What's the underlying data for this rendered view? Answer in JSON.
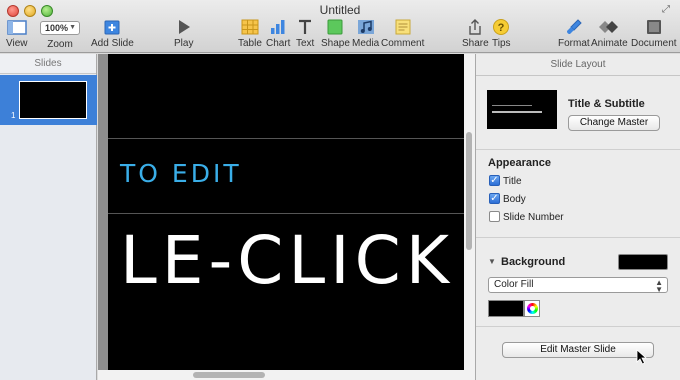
{
  "window": {
    "title": "Untitled"
  },
  "toolbar": {
    "view": "View",
    "zoom_value": "100%",
    "zoom": "Zoom",
    "add_slide": "Add Slide",
    "play": "Play",
    "table": "Table",
    "chart": "Chart",
    "text": "Text",
    "shape": "Shape",
    "media": "Media",
    "comment": "Comment",
    "share": "Share",
    "tips": "Tips",
    "format": "Format",
    "animate": "Animate",
    "document": "Document"
  },
  "navigator": {
    "header": "Slides",
    "slides": [
      {
        "number": "1"
      }
    ]
  },
  "slide": {
    "subtitle": "TO EDIT",
    "title": "LE-CLICK"
  },
  "inspector": {
    "header": "Slide Layout",
    "master_name": "Title & Subtitle",
    "change_master": "Change Master",
    "appearance": {
      "title": "Appearance",
      "options": [
        {
          "label": "Title",
          "checked": true
        },
        {
          "label": "Body",
          "checked": true
        },
        {
          "label": "Slide Number",
          "checked": false
        }
      ]
    },
    "background": {
      "title": "Background",
      "fill_type": "Color Fill",
      "color": "#000000"
    },
    "edit_master": "Edit Master Slide"
  },
  "colors": {
    "accent_blue": "#3d80d8",
    "subtitle_blue": "#3aaee8"
  }
}
